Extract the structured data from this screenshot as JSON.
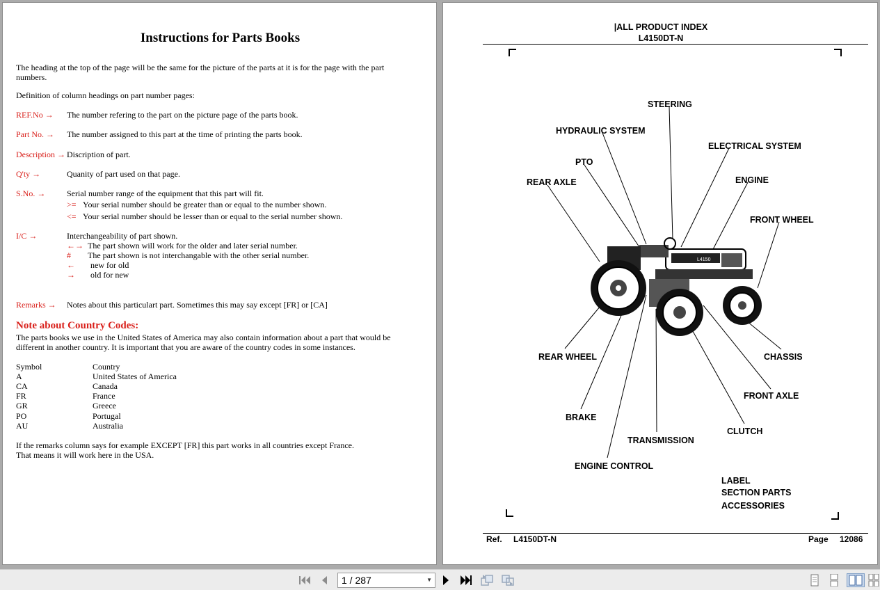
{
  "left_page": {
    "title": "Instructions for Parts Books",
    "intro_line1": "The heading at the top of the page will be the same for the picture of the parts at it is for the page with the part",
    "intro_line2": "numbers.",
    "definition_heading": "Definition of column headings on part number pages:",
    "definitions": [
      {
        "term": "REF.No →",
        "desc": "The number refering to the part on the picture page of the parts book."
      },
      {
        "term": "Part No. →",
        "desc": "The number assigned to this part at the time of printing the parts book."
      },
      {
        "term": "Description →",
        "desc": "Discription of part."
      },
      {
        "term": "Q'ty →",
        "desc": "Quanity of part used on that page."
      },
      {
        "term": "S.No. →",
        "desc": "Serial number range of the equipment that this part will fit."
      },
      {
        "term": "I/C →",
        "desc": "Interchangeability of part shown."
      },
      {
        "term": "Remarks →",
        "desc": "Notes about this particulart part. Sometimes this may say except [FR] or [CA]"
      }
    ],
    "serial_notes": [
      {
        "symbol": ">=",
        "text": "Your serial number should be greater than or equal to the number shown."
      },
      {
        "symbol": "<=",
        "text": "Your serial number should be lesser than or equal to the serial number shown."
      }
    ],
    "ic_notes": [
      {
        "symbol": "←→",
        "text": "The part shown will work for the older and later serial number."
      },
      {
        "symbol": "#",
        "text": "The part shown is not interchangable with the other serial number."
      },
      {
        "symbol": "←",
        "text": "new for old"
      },
      {
        "symbol": "→",
        "text": "old for new"
      }
    ],
    "country_heading": "Note about Country Codes:",
    "country_para1": "The parts books we use in the United States of America may also contain information about a part that would be",
    "country_para2": "different in another country. It is important that you are aware of the country codes in some instances.",
    "codes_header": {
      "symbol": "Symbol",
      "country": "Country"
    },
    "codes": [
      {
        "symbol": "A",
        "country": "United States of America"
      },
      {
        "symbol": "CA",
        "country": "Canada"
      },
      {
        "symbol": "FR",
        "country": "France"
      },
      {
        "symbol": "GR",
        "country": "Greece"
      },
      {
        "symbol": "PO",
        "country": "Portugal"
      },
      {
        "symbol": "AU",
        "country": "Australia"
      }
    ],
    "closing1": "If the remarks column says for example EXCEPT [FR] this part works in all countries except France.",
    "closing2": "That means it will work here in the USA."
  },
  "right_page": {
    "header1": "|ALL PRODUCT INDEX",
    "header2": "L4150DT-N",
    "callouts": {
      "steering": "STEERING",
      "hydraulic": "HYDRAULIC SYSTEM",
      "electrical": "ELECTRICAL SYSTEM",
      "pto": "PTO",
      "engine": "ENGINE",
      "rear_axle": "REAR AXLE",
      "front_wheel": "FRONT WHEEL",
      "rear_wheel": "REAR WHEEL",
      "chassis": "CHASSIS",
      "front_axle": "FRONT AXLE",
      "brake": "BRAKE",
      "clutch": "CLUTCH",
      "transmission": "TRANSMISSION",
      "engine_control": "ENGINE CONTROL"
    },
    "tractor_badge": "L4150",
    "side_labels": [
      "LABEL",
      "SECTION PARTS",
      "ACCESSORIES"
    ],
    "footer": {
      "ref_label": "Ref.",
      "ref_value": "L4150DT-N",
      "page_label": "Page",
      "page_value": "12086"
    }
  },
  "toolbar": {
    "page_indicator": "1 / 287",
    "icons": [
      "first-page-icon",
      "previous-page-icon",
      "next-page-icon",
      "last-page-icon",
      "previous-view-icon",
      "next-view-icon",
      "single-page-icon",
      "continuous-icon",
      "facing-icon",
      "continuous-facing-icon"
    ]
  }
}
